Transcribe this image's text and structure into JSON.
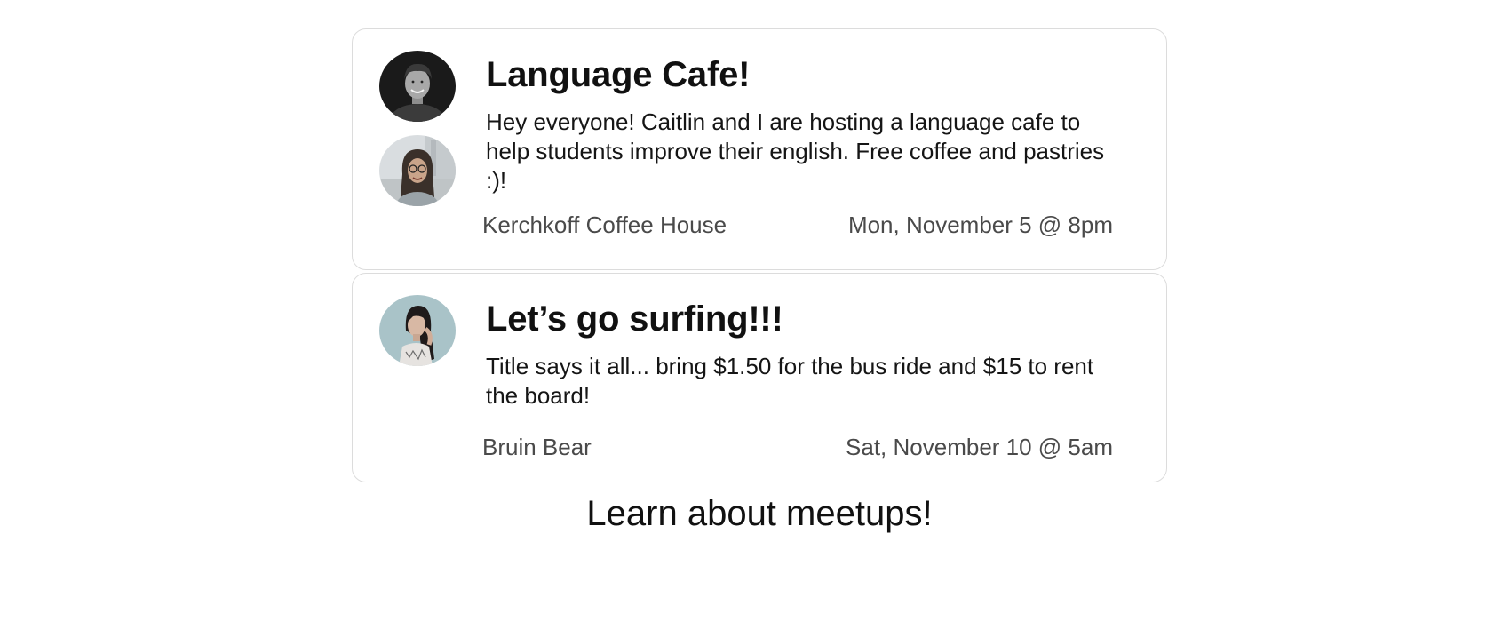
{
  "events": [
    {
      "title": "Language Cafe!",
      "description": "Hey everyone! Caitlin and I are hosting a language cafe to help students improve their english. Free coffee and pastries :)!",
      "location": "Kerchkoff Coffee House",
      "datetime": "Mon, November 5 @ 8pm",
      "avatars": [
        "avatar-young-man",
        "avatar-woman-glasses"
      ]
    },
    {
      "title": "Let’s go surfing!!!",
      "description": "Title says it all... bring $1.50 for the bus ride and $15 to rent the board!",
      "location": "Bruin Bear",
      "datetime": "Sat, November 10 @ 5am",
      "avatars": [
        "avatar-woman-dark-hair"
      ]
    }
  ],
  "footer": {
    "label": "Learn about meetups!"
  },
  "colors": {
    "card_border": "#dcdcdc",
    "text_primary": "#111111",
    "text_meta": "#4a4a4a"
  }
}
